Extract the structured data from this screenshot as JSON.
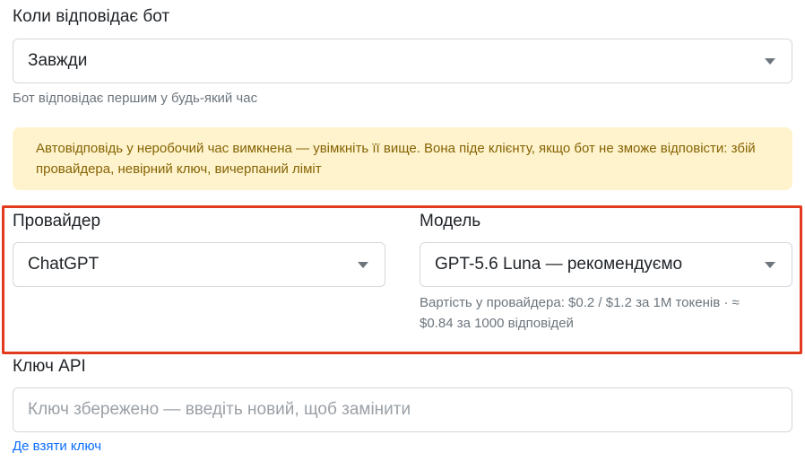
{
  "reply_mode": {
    "label": "Коли відповідає бот",
    "selected": "Завжди",
    "hint": "Бот відповідає першим у будь-який час"
  },
  "alert": {
    "text": "Автовідповідь у неробочий час вимкнена — увімкніть її вище. Вона піде клієнту, якщо бот не зможе відповісти: збій провайдера, невірний ключ, вичерпаний ліміт"
  },
  "provider": {
    "label": "Провайдер",
    "selected": "ChatGPT"
  },
  "model": {
    "label": "Модель",
    "selected": "GPT-5.6 Luna — рекомендуємо",
    "cost_line1": "Вартість у провайдера: $0.2 / $1.2 за 1M токенів · ≈",
    "cost_line2": "$0.84 за 1000 відповідей"
  },
  "api_key": {
    "label": "Ключ API",
    "placeholder": "Ключ збережено — введіть новий, щоб замінити",
    "help_link": "Де взяти ключ"
  },
  "colors": {
    "alert_bg": "#fff3cd",
    "alert_text": "#856404",
    "highlight_border": "#e23a1c",
    "link": "#0d6efd"
  }
}
